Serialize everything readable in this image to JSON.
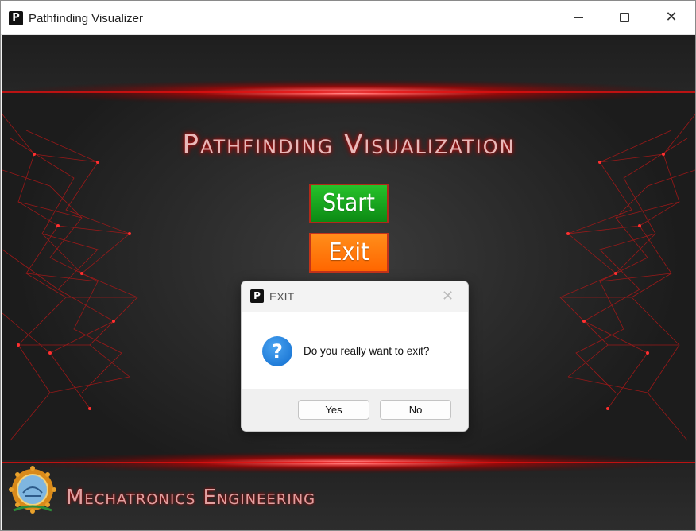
{
  "window": {
    "title": "Pathfinding Visualizer",
    "app_icon_glyph": "P"
  },
  "main": {
    "heading": "Pathfinding Visualization",
    "start_label": "Start",
    "exit_label": "Exit",
    "footer_text": "Mechatronics Engineering"
  },
  "dialog": {
    "title": "EXIT",
    "icon_glyph": "P",
    "message": "Do you really want to exit?",
    "question_glyph": "?",
    "yes_label": "Yes",
    "no_label": "No"
  },
  "colors": {
    "accent_red": "#e01010",
    "start_green": "#1aa81f",
    "exit_orange": "#ff7a0d"
  }
}
